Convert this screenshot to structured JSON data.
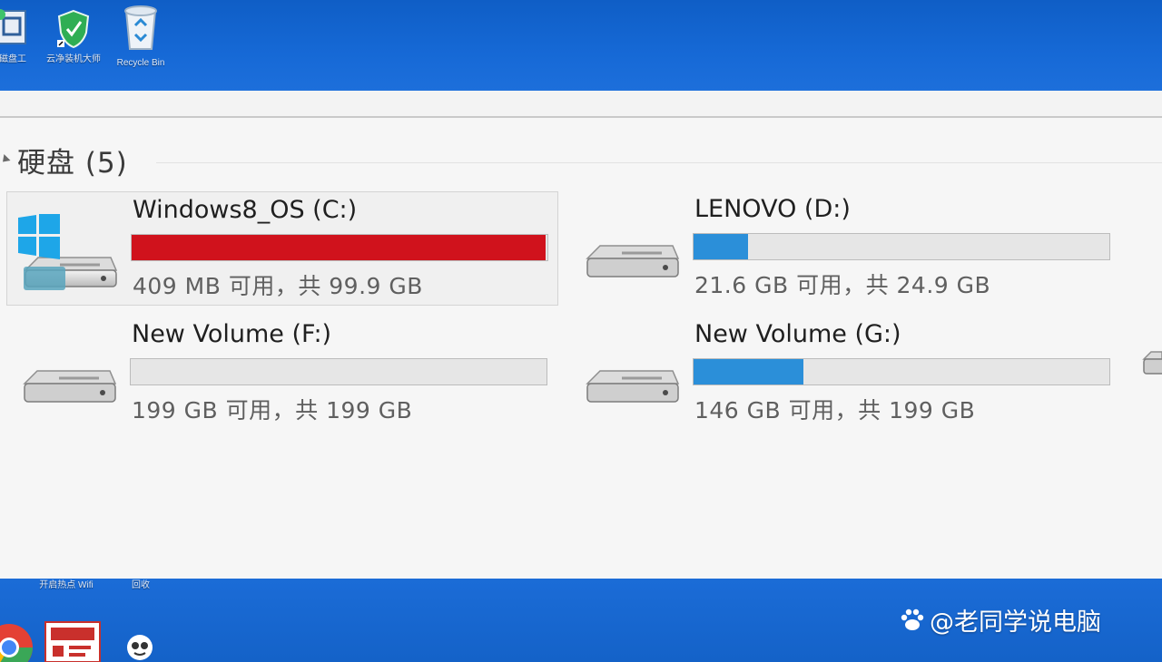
{
  "desktop": {
    "top_icons": [
      {
        "name": "partition-tool-icon",
        "label": "磁盘工"
      },
      {
        "name": "security-shield-icon",
        "label": "云净装机大师"
      },
      {
        "name": "recycle-bin-icon",
        "label": "Recycle Bin"
      }
    ],
    "bottom_labels": [
      "开启热点 Wifi",
      "回收"
    ]
  },
  "explorer": {
    "group": {
      "title": "硬盘 (5)"
    },
    "drives": [
      {
        "name": "Windows8_OS (C:)",
        "space": "409 MB 可用，共 99.9 GB",
        "used_fraction": 0.996,
        "bar_color": "#d0121c",
        "windows_logo": true,
        "selected": true
      },
      {
        "name": "LENOVO (D:)",
        "space": "21.6 GB 可用，共 24.9 GB",
        "used_fraction": 0.13,
        "bar_color": "#2b8fd9",
        "windows_logo": false,
        "selected": false
      },
      {
        "name": "New Volume (F:)",
        "space": "199 GB 可用，共 199 GB",
        "used_fraction": 0.0,
        "bar_color": "#2b8fd9",
        "windows_logo": false,
        "selected": false
      },
      {
        "name": "New Volume (G:)",
        "space": "146 GB 可用，共 199 GB",
        "used_fraction": 0.265,
        "bar_color": "#2b8fd9",
        "windows_logo": false,
        "selected": false
      }
    ]
  },
  "watermark": {
    "text": "@老同学说电脑"
  }
}
